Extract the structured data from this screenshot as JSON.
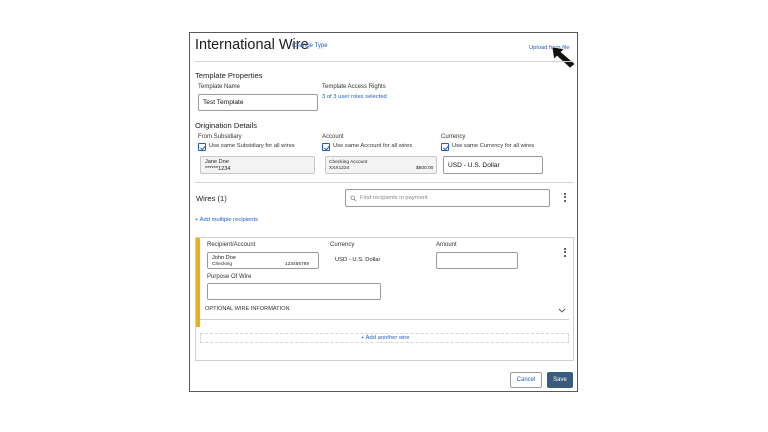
{
  "header": {
    "title": "International Wire",
    "change_type": "Change Type",
    "upload": "Upload from file"
  },
  "template_properties": {
    "heading": "Template Properties",
    "name_label": "Template Name",
    "name_value": "Test Template",
    "access_label": "Template Access Rights",
    "access_link": "3 of 3 user roles selected"
  },
  "origination": {
    "heading": "Origination Details",
    "subsidiary": {
      "label": "From Subsidiary",
      "checkbox": "Use same Subsidiary for all wires",
      "name": "Jane Doe",
      "number": "******1234"
    },
    "account": {
      "label": "Account",
      "checkbox": "Use same Account for all wires",
      "type": "Checking Account",
      "number": "XXX1234",
      "balance": "$500.00"
    },
    "currency": {
      "label": "Currency",
      "checkbox": "Use same Currency for all wires",
      "value": "USD - U.S. Dollar"
    }
  },
  "wires": {
    "heading": "Wires (1)",
    "search_placeholder": "Find recipients in payment",
    "add_multiple": "+ Add multiple recipients"
  },
  "wire_card": {
    "recipient_label": "Recipient/Account",
    "recipient_name": "John Doe",
    "recipient_type": "Checking",
    "recipient_number": "123456789",
    "currency_label": "Currency",
    "currency_value": "USD - U.S. Dollar",
    "amount_label": "Amount",
    "amount_value": "",
    "purpose_label": "Purpose Of Wire",
    "purpose_value": "",
    "optional_info": "OPTIONAL WIRE INFORMATION",
    "add_another": "+ Add another wire"
  },
  "footer": {
    "cancel": "Cancel",
    "save": "Save"
  },
  "colors": {
    "link": "#1f5fbf",
    "accent": "#e3b222",
    "save_button": "#3a5c7c"
  }
}
